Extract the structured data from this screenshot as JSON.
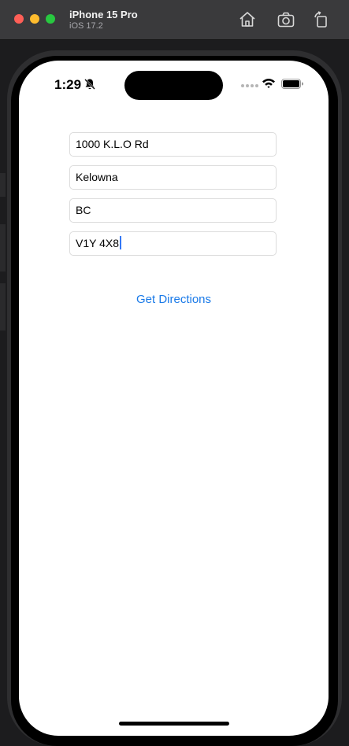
{
  "window": {
    "device_name": "iPhone 15 Pro",
    "os_version": "iOS 17.2",
    "toolbar_icons": [
      "home-icon",
      "screenshot-icon",
      "rotate-icon"
    ]
  },
  "status_bar": {
    "time": "1:29",
    "icons": [
      "bell-slash-icon",
      "cellular-dots-icon",
      "wifi-icon",
      "battery-icon"
    ]
  },
  "form": {
    "street": "1000 K.L.O Rd",
    "city": "Kelowna",
    "province": "BC",
    "postal_code": "V1Y 4X8"
  },
  "actions": {
    "get_directions_label": "Get Directions"
  },
  "colors": {
    "accent": "#1a7ae8",
    "titlebar": "#3a3a3c",
    "traffic_red": "#ff5f57",
    "traffic_yellow": "#febc2e",
    "traffic_green": "#28c840"
  }
}
